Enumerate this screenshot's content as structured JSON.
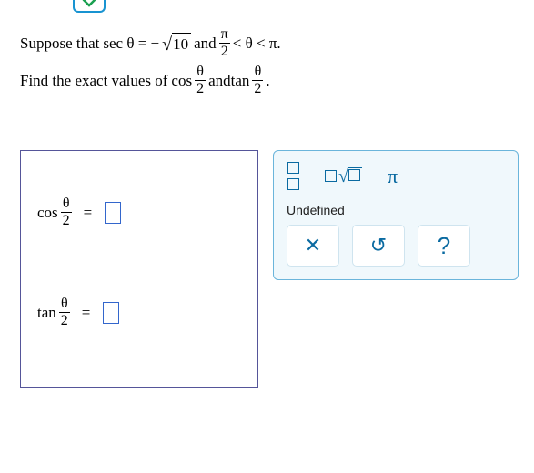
{
  "problem": {
    "prefix": "Suppose that ",
    "sec_lhs": "sec θ = −",
    "sqrt_val": "10",
    "and1": " and ",
    "frac_top1": "π",
    "frac_bot1": "2",
    "ineq": " < θ < π.",
    "line2_a": "Find the exact values of ",
    "cos": "cos",
    "frac_top2": "θ",
    "frac_bot2": "2",
    "and2": " and ",
    "tan": "tan",
    "period": "."
  },
  "answers": {
    "cos_label": "cos",
    "tan_label": "tan",
    "theta": "θ",
    "two": "2",
    "eq": "="
  },
  "panel": {
    "pi": "π",
    "undefined": "Undefined",
    "close": "✕",
    "reset": "↺",
    "help": "?"
  }
}
